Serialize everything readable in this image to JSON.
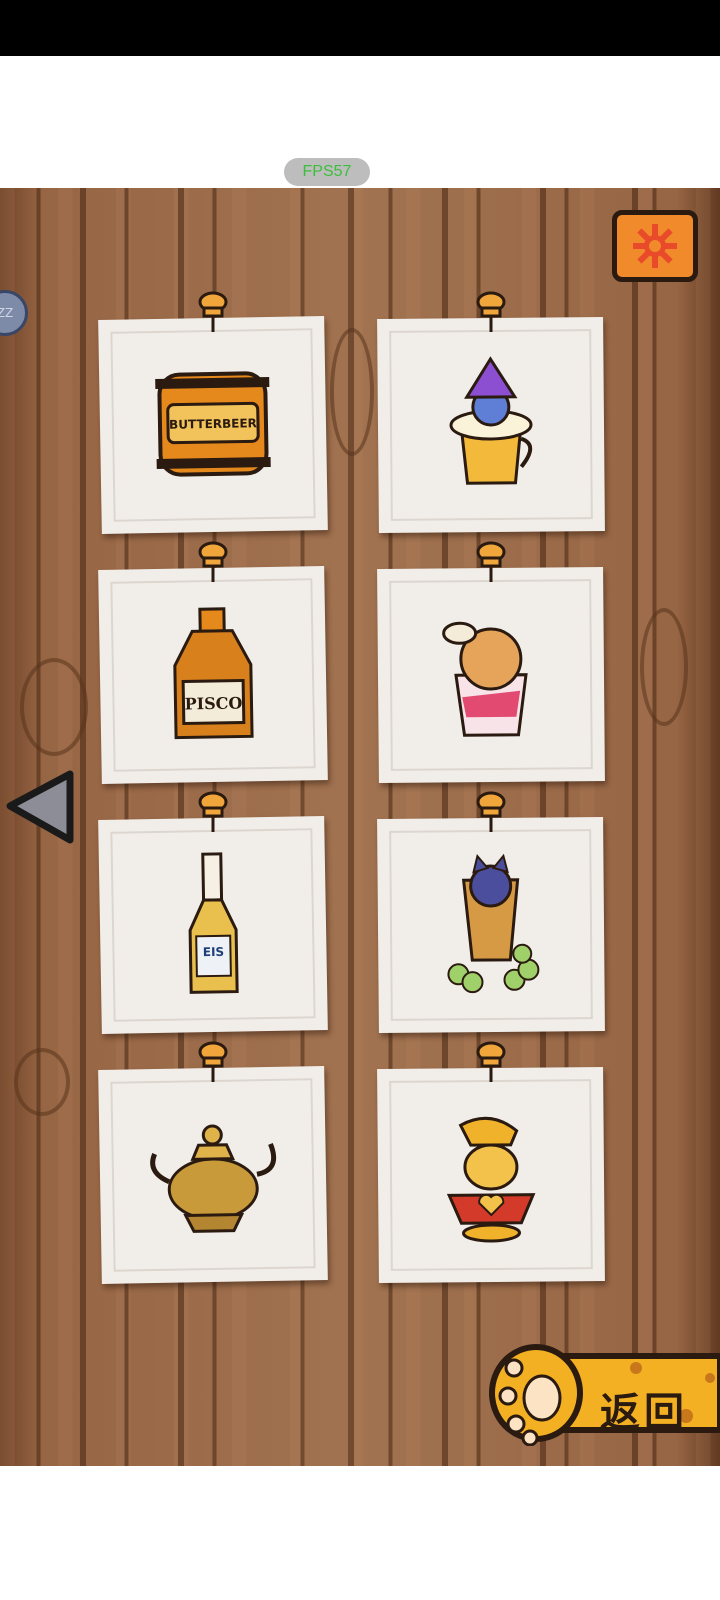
{
  "overlay": {
    "fps_label": "FPS57"
  },
  "left_edge_badge": "ZZ",
  "colors": {
    "board": "#a97a57",
    "card": "#f1eeea",
    "accent": "#f08a2a",
    "outline": "#2a1a10"
  },
  "cards": [
    {
      "name": "butterbeer",
      "icon": "barrel-icon",
      "text": "BUTTERBEER"
    },
    {
      "name": "wizard-cat-cup",
      "icon": "wizard-cat-mug-icon",
      "text": ""
    },
    {
      "name": "pisco",
      "icon": "bottle-icon",
      "text": "PISCO"
    },
    {
      "name": "llama-cup",
      "icon": "llama-drink-icon",
      "text": ""
    },
    {
      "name": "eis",
      "icon": "tall-bottle-icon",
      "text": "EIS"
    },
    {
      "name": "cat-grape-glass",
      "icon": "cat-glass-icon",
      "text": ""
    },
    {
      "name": "teapot",
      "icon": "teapot-icon",
      "text": ""
    },
    {
      "name": "cat-lamp",
      "icon": "cat-lamp-icon",
      "text": ""
    }
  ],
  "controls": {
    "back_label": "返回"
  }
}
